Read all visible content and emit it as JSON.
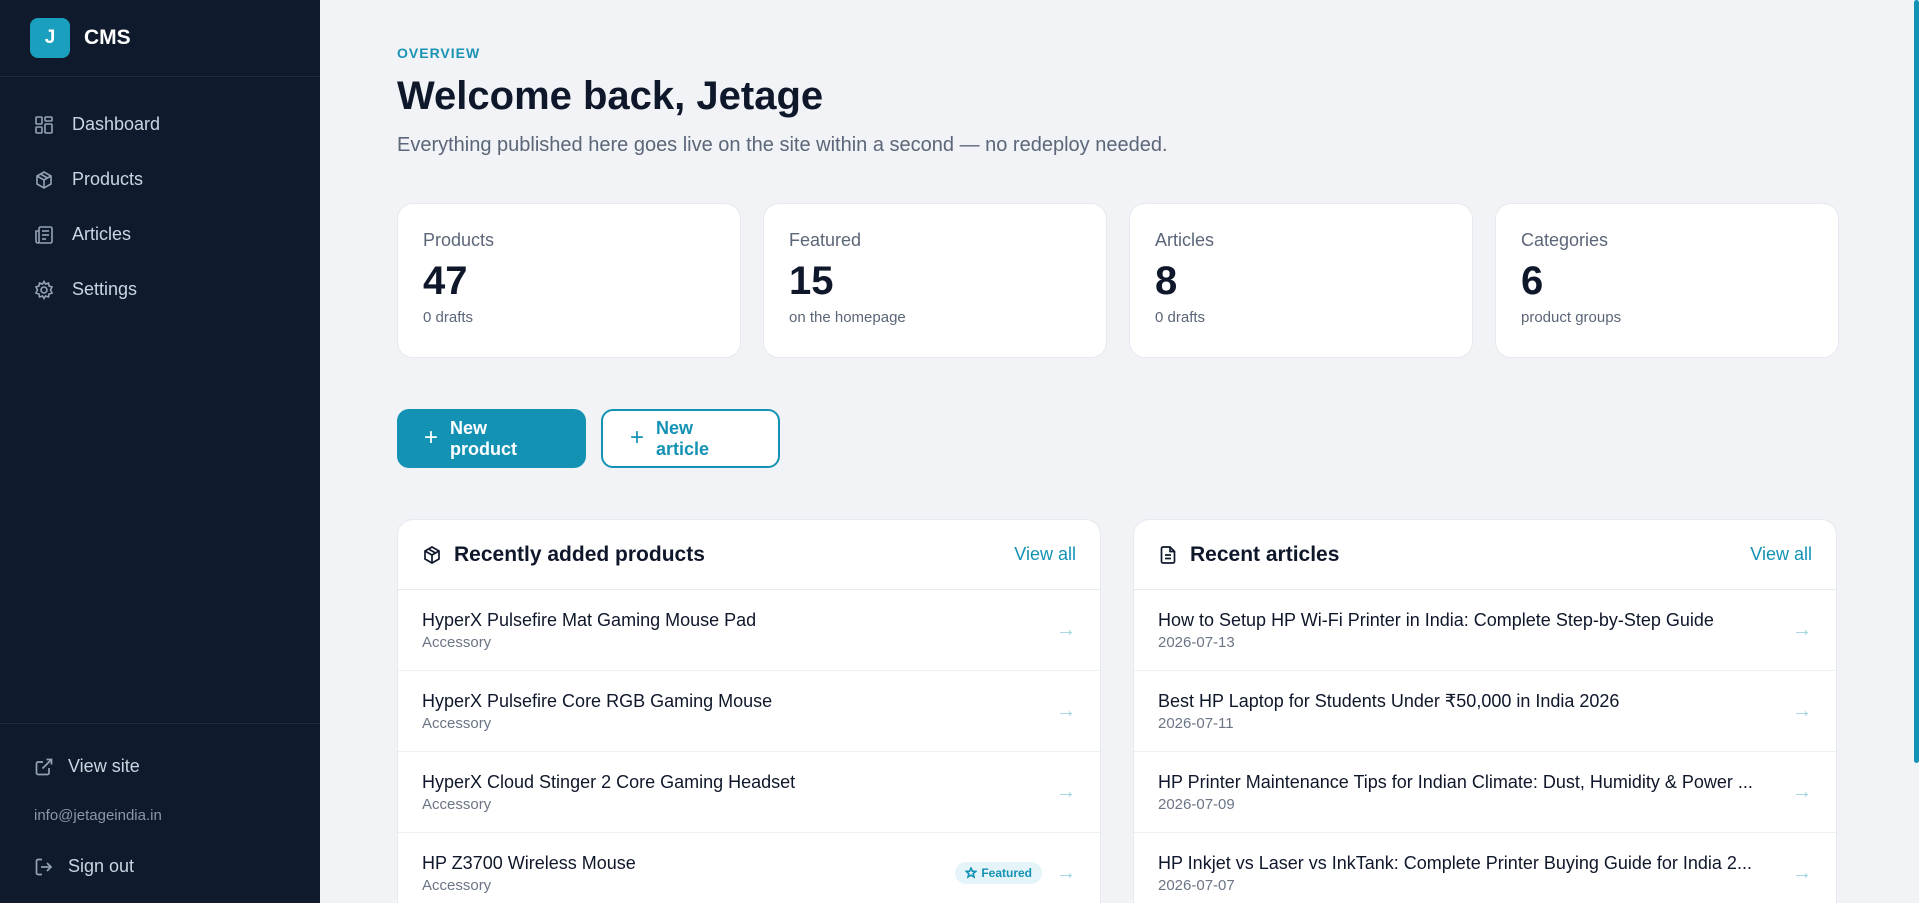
{
  "brand": {
    "logo_letter": "J",
    "name": "CMS"
  },
  "nav": [
    {
      "label": "Dashboard",
      "icon": "dashboard-icon"
    },
    {
      "label": "Products",
      "icon": "box-icon"
    },
    {
      "label": "Articles",
      "icon": "newspaper-icon"
    },
    {
      "label": "Settings",
      "icon": "gear-icon"
    }
  ],
  "sidebar_bottom": {
    "view_site": "View site",
    "email": "info@jetageindia.in",
    "sign_out": "Sign out"
  },
  "header": {
    "eyebrow": "OVERVIEW",
    "title": "Welcome back, Jetage",
    "subtitle": "Everything published here goes live on the site within a second — no redeploy needed."
  },
  "stats": [
    {
      "label": "Products",
      "value": "47",
      "note": "0 drafts"
    },
    {
      "label": "Featured",
      "value": "15",
      "note": "on the homepage"
    },
    {
      "label": "Articles",
      "value": "8",
      "note": "0 drafts"
    },
    {
      "label": "Categories",
      "value": "6",
      "note": "product groups"
    }
  ],
  "actions": {
    "new_product": "New product",
    "new_article": "New article"
  },
  "products_panel": {
    "title": "Recently added products",
    "view_all": "View all",
    "items": [
      {
        "title": "HyperX Pulsefire Mat Gaming Mouse Pad",
        "category": "Accessory",
        "badge": ""
      },
      {
        "title": "HyperX Pulsefire Core RGB Gaming Mouse",
        "category": "Accessory",
        "badge": ""
      },
      {
        "title": "HyperX Cloud Stinger 2 Core Gaming Headset",
        "category": "Accessory",
        "badge": ""
      },
      {
        "title": "HP Z3700 Wireless Mouse",
        "category": "Accessory",
        "badge": "Featured"
      }
    ]
  },
  "articles_panel": {
    "title": "Recent articles",
    "view_all": "View all",
    "items": [
      {
        "title": "How to Setup HP Wi-Fi Printer in India: Complete Step-by-Step Guide",
        "date": "2026-07-13"
      },
      {
        "title": "Best HP Laptop for Students Under ₹50,000 in India 2026",
        "date": "2026-07-11"
      },
      {
        "title": "HP Printer Maintenance Tips for Indian Climate: Dust, Humidity & Power ...",
        "date": "2026-07-09"
      },
      {
        "title": "HP Inkjet vs Laser vs InkTank: Complete Printer Buying Guide for India 2...",
        "date": "2026-07-07"
      }
    ]
  },
  "colors": {
    "accent": "#1492b4",
    "sidebar_bg": "#0f1a2c",
    "page_bg": "#f1f3f6"
  }
}
